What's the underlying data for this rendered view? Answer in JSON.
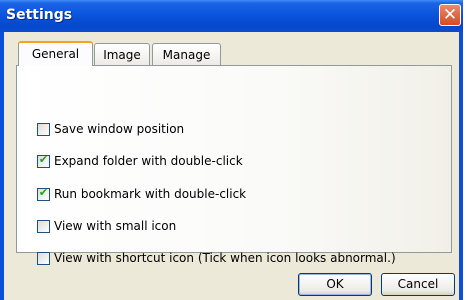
{
  "window": {
    "title": "Settings",
    "close_glyph": "✕"
  },
  "tabs": [
    {
      "label": "General",
      "active": true
    },
    {
      "label": "Image",
      "active": false
    },
    {
      "label": "Manage",
      "active": false
    }
  ],
  "options": [
    {
      "label": "Save window position",
      "checked": false
    },
    {
      "label": "Expand folder with double-click",
      "checked": true
    },
    {
      "label": "Run bookmark with double-click",
      "checked": true
    },
    {
      "label": "View with small icon",
      "checked": false
    },
    {
      "label": "View with shortcut icon (Tick when icon looks abnormal.)",
      "checked": false
    }
  ],
  "buttons": {
    "ok": "OK",
    "cancel": "Cancel"
  },
  "check_glyph": "✔"
}
